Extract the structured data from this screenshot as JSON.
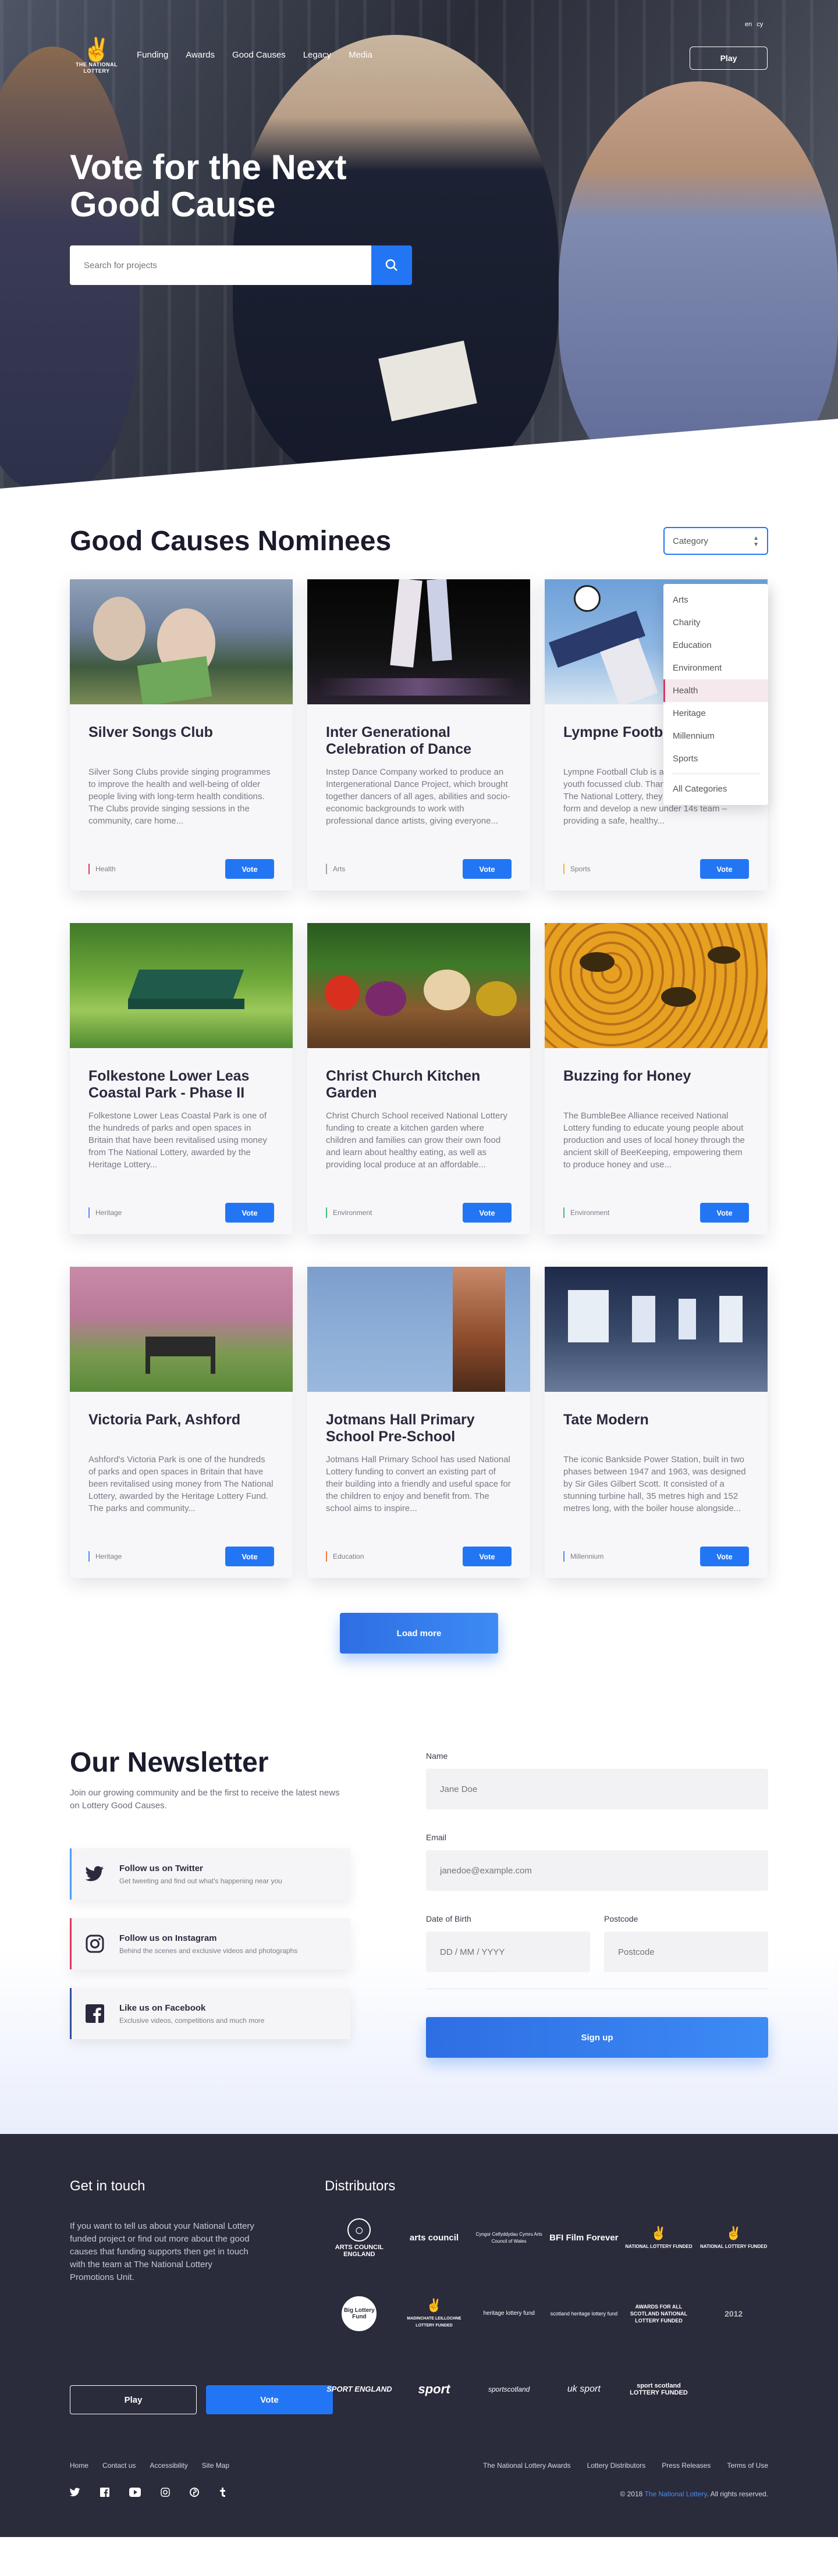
{
  "header": {
    "logo_text": "THE NATIONAL LOTTERY",
    "nav": [
      "Funding",
      "Awards",
      "Good Causes",
      "Legacy",
      "Media"
    ],
    "lang": [
      "en",
      "cy"
    ],
    "play_label": "Play"
  },
  "hero": {
    "title_line1": "Vote for the Next",
    "title_line2": "Good Cause",
    "search_placeholder": "Search for projects"
  },
  "nominees": {
    "title": "Good Causes Nominees",
    "select_value": "Category",
    "menu": [
      "Arts",
      "Charity",
      "Education",
      "Environment",
      "Health",
      "Heritage",
      "Millennium",
      "Sports"
    ],
    "menu_selected": "Health",
    "menu_all": "All Categories",
    "vote_label": "Vote",
    "load_more": "Load more",
    "cards": [
      {
        "title": "Silver Songs Club",
        "desc": "Silver Song Clubs provide singing programmes to improve the health and well-being of older people living with long-term health conditions. The Clubs provide singing sessions in the community, care home...",
        "tag": "Health",
        "tag_color": "#e2365f"
      },
      {
        "title": "Inter Generational Celebration of Dance",
        "desc": "Instep Dance Company worked to produce an Intergenerational Dance Project, which brought together dancers of all ages, abilities and socio-economic backgrounds to work with professional dance artists, giving everyone...",
        "tag": "Arts",
        "tag_color": "#9aa0b0"
      },
      {
        "title": "Lympne Football Club",
        "desc": "Lympne Football Club is a recently established youth focussed club. Thanks to a grant from The National Lottery, they have been able to form and develop a new under 14s team – providing a safe, healthy...",
        "tag": "Sports",
        "tag_color": "#f3b43b"
      },
      {
        "title": "Folkestone Lower Leas Coastal Park - Phase II",
        "desc": "Folkestone Lower Leas Coastal Park is one of the hundreds of parks and open spaces in Britain that have been revitalised using money from The National Lottery, awarded by the Heritage Lottery...",
        "tag": "Heritage",
        "tag_color": "#4b8cf6"
      },
      {
        "title": "Christ Church Kitchen Garden",
        "desc": "Christ Church School received National Lottery funding to create a kitchen garden where children and families can grow their own food and learn about healthy eating, as well as providing local produce at an affordable...",
        "tag": "Environment",
        "tag_color": "#3fbf6f"
      },
      {
        "title": "Buzzing for Honey",
        "desc": "The BumbleBee Alliance received National Lottery funding to educate young people about production and uses of local honey through the ancient skill of BeeKeeping, empowering them to produce honey and use...",
        "tag": "Environment",
        "tag_color": "#3fbf6f"
      },
      {
        "title": "Victoria Park, Ashford",
        "desc": "Ashford's Victoria Park is one of the hundreds of parks and open spaces in Britain that have been revitalised using money from The National Lottery, awarded by the Heritage Lottery Fund. The parks and community...",
        "tag": "Heritage",
        "tag_color": "#4b8cf6"
      },
      {
        "title": "Jotmans Hall Primary School Pre-School",
        "desc": "Jotmans Hall Primary School has used National Lottery funding to convert an existing part of their building into a friendly and useful space for the children to enjoy and benefit from. The school aims to inspire...",
        "tag": "Education",
        "tag_color": "#f07b3c"
      },
      {
        "title": "Tate Modern",
        "desc": "The iconic Bankside Power Station, built in two phases between 1947 and 1963, was designed by Sir Giles Gilbert Scott. It consisted of a stunning turbine hall, 35 metres high and 152 metres long, with the boiler house alongside...",
        "tag": "Millennium",
        "tag_color": "#4b8cf6"
      }
    ]
  },
  "newsletter": {
    "title": "Our Newsletter",
    "subtitle": "Join our growing community and be the first to receive the latest news on Lottery Good Causes.",
    "social": [
      {
        "title": "Follow us on Twitter",
        "sub": "Get tweeting and find out what's happening near you",
        "color": "#4b9df6",
        "icon": "twitter-icon"
      },
      {
        "title": "Follow us on Instagram",
        "sub": "Behind the scenes and exclusive videos and photographs",
        "color": "#e2365f",
        "icon": "instagram-icon"
      },
      {
        "title": "Like us on Facebook",
        "sub": "Exclusive videos, competitions and much more",
        "color": "#2f4f9f",
        "icon": "facebook-icon"
      }
    ],
    "name_label": "Name",
    "name_placeholder": "Jane Doe",
    "email_label": "Email",
    "email_placeholder": "janedoe@example.com",
    "dob_label": "Date of Birth",
    "dob_placeholder": "DD / MM / YYYY",
    "postcode_label": "Postcode",
    "postcode_placeholder": "Postcode",
    "signup_label": "Sign up"
  },
  "footer": {
    "git_title": "Get in touch",
    "git_text": "If you want to tell us about your National Lottery funded project or find out more about the good causes that funding supports then get in touch with the team at The National Lottery Promotions Unit.",
    "play_label": "Play",
    "vote_label": "Vote",
    "dist_title": "Distributors",
    "distributors": [
      "ARTS COUNCIL ENGLAND",
      "arts council",
      "Cyngor Celfyddydau Cymru Arts Council of Wales",
      "BFI Film Forever",
      "NATIONAL LOTTERY FUNDED",
      "NATIONAL LOTTERY FUNDED",
      "Big Lottery Fund",
      "MADINCHATE LEILLOCHNE LOTTERY FUNDED",
      "heritage lottery fund",
      "scotland heritage lottery fund",
      "AWARDS FOR ALL SCOTLAND NATIONAL LOTTERY FUNDED",
      "2012",
      "SPORT ENGLAND",
      "sport",
      "sportscotland",
      "uk sport",
      "sport scotland LOTTERY FUNDED"
    ],
    "links_left": [
      "Home",
      "Contact us",
      "Accessibility",
      "Site Map"
    ],
    "links_right": [
      "The National Lottery Awards",
      "Lottery Distributors",
      "Press Releases",
      "Terms of Use"
    ],
    "copyright_pre": "© 2018",
    "copyright_link": "The National Lottery",
    "copyright_post": ". All rights reserved."
  }
}
